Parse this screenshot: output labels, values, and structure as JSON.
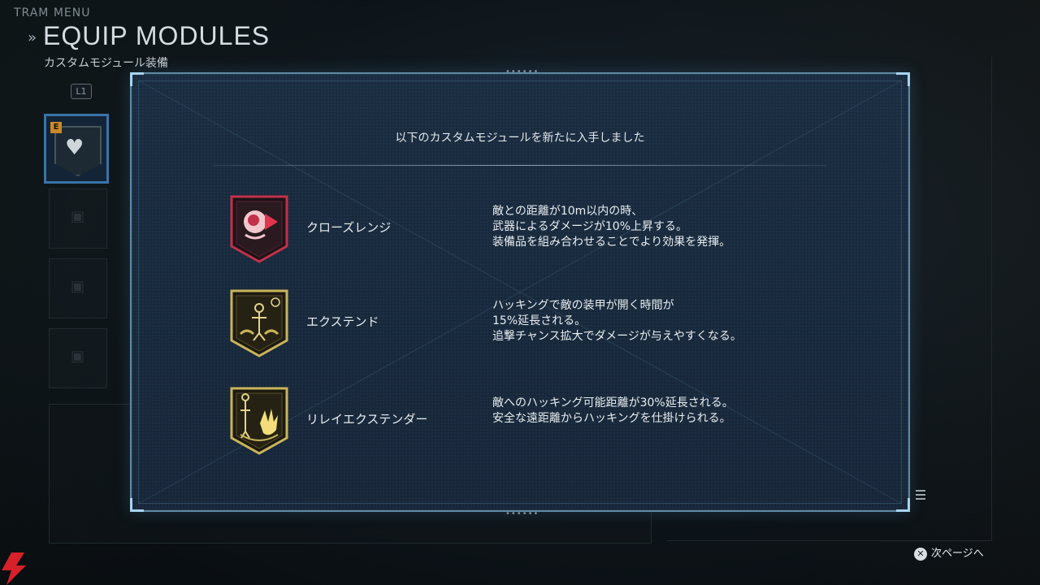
{
  "header": {
    "small_label": "TRAM MENU",
    "chevron": "»",
    "title": "EQUIP MODULES",
    "subtitle": "カスタムモジュール装備",
    "shoulder_button": "L1"
  },
  "left_slots": {
    "active_tag": "E",
    "active_icon": "heart-plus-icon",
    "locked_icon": "lock-icon"
  },
  "dialog": {
    "title": "以下のカスタムモジュールを新たに入手しました",
    "modules": [
      {
        "name": "クローズレンジ",
        "icon": "close-range-icon",
        "color": "#c2304a",
        "description": "敵との距離が10m以内の時、\n武器によるダメージが10%上昇する。\n装備品を組み合わせることでより効果を発揮。"
      },
      {
        "name": "エクステンド",
        "icon": "extend-icon",
        "color": "#c9b45a",
        "description": "ハッキングで敵の装甲が開く時間が\n15%延長される。\n追撃チャンス拡大でダメージが与えやすくなる。"
      },
      {
        "name": "リレイエクステンダー",
        "icon": "relay-extender-icon",
        "color": "#c9b45a",
        "description": "敵へのハッキング可能距離が30%延長される。\n安全な遠距離からハッキングを仕掛けられる。"
      }
    ]
  },
  "footer": {
    "next_button_glyph": "✕",
    "next_label": "次ページへ"
  },
  "colors": {
    "frame": "#5e8aa6",
    "frame_corner": "#a7d4ee",
    "panel_bg": "#1a2c40",
    "accent_red": "#c2304a",
    "accent_gold": "#c9b45a"
  }
}
